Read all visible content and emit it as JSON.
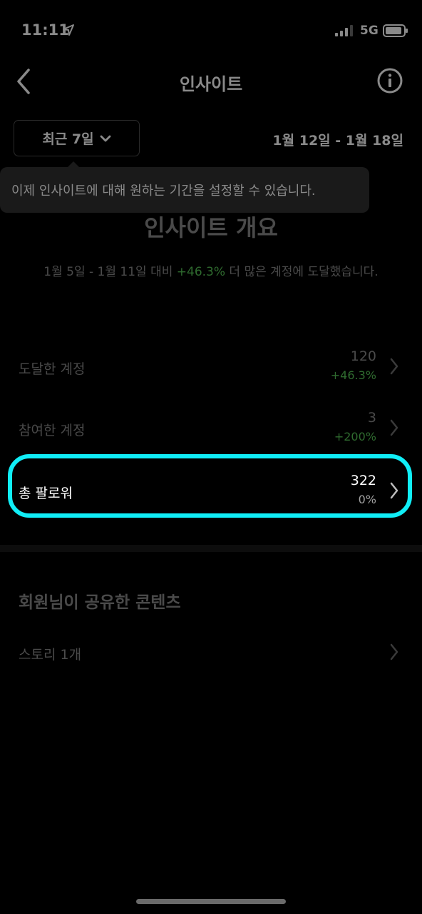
{
  "status": {
    "time": "11:11",
    "network": "5G"
  },
  "nav": {
    "title": "인사이트"
  },
  "filter": {
    "range_label": "최근 7일",
    "date_range": "1월 12일 - 1월 18일"
  },
  "tooltip": {
    "text": "이제 인사이트에 대해 원하는 기간을 설정할 수 있습니다."
  },
  "overview": {
    "title": "인사이트 개요",
    "desc_prefix": "1월 5일 - 1월 11일 대비 ",
    "desc_highlight": "+46.3%",
    "desc_suffix": " 더 많은 계정에 도달했습니다."
  },
  "metrics": [
    {
      "label": "도달한 계정",
      "value": "120",
      "change": "+46.3%"
    },
    {
      "label": "참여한 계정",
      "value": "3",
      "change": "+200%"
    },
    {
      "label": "총 팔로워",
      "value": "322",
      "change": "0%"
    }
  ],
  "content_section": {
    "title": "회원님이 공유한 콘텐츠",
    "items": [
      {
        "label": "스토리 1개"
      }
    ]
  },
  "colors": {
    "highlight": "#10eef7",
    "positive": "#2f6b2f"
  }
}
